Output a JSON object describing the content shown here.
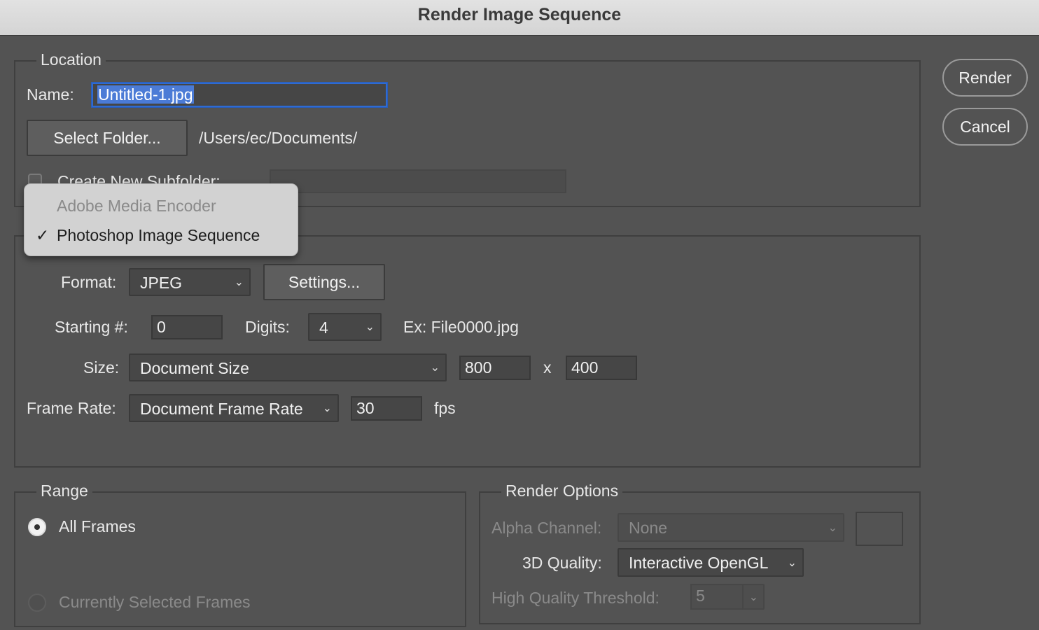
{
  "window": {
    "title": "Render Image Sequence"
  },
  "location": {
    "legend": "Location",
    "name_label": "Name:",
    "name_value": "Untitled-1.jpg",
    "select_folder_label": "Select Folder...",
    "folder_path": "/Users/ec/Documents/",
    "create_subfolder_label": "Create New Subfolder:",
    "create_subfolder_checked": false,
    "subfolder_value": ""
  },
  "renderer_menu": {
    "items": [
      {
        "label": "Adobe Media Encoder",
        "enabled": false,
        "checked": false
      },
      {
        "label": "Photoshop Image Sequence",
        "enabled": true,
        "checked": true
      }
    ],
    "checkmark": "✓"
  },
  "settings": {
    "format_label": "Format:",
    "format_value": "JPEG",
    "settings_button": "Settings...",
    "starting_label": "Starting #:",
    "starting_value": "0",
    "digits_label": "Digits:",
    "digits_value": "4",
    "example_text": "Ex: File0000.jpg",
    "size_label": "Size:",
    "size_value": "Document Size",
    "width_value": "800",
    "size_separator": "x",
    "height_value": "400",
    "frame_rate_label": "Frame Rate:",
    "frame_rate_value": "Document Frame Rate",
    "fps_value": "30",
    "fps_unit": "fps"
  },
  "range": {
    "legend": "Range",
    "all_frames_label": "All Frames",
    "all_frames_selected": true,
    "selected_frames_label": "Currently Selected Frames",
    "selected_frames_enabled": false
  },
  "render_options": {
    "legend": "Render Options",
    "alpha_label": "Alpha Channel:",
    "alpha_value": "None",
    "quality_label": "3D Quality:",
    "quality_value": "Interactive OpenGL",
    "threshold_label": "High Quality Threshold:",
    "threshold_value": "5"
  },
  "actions": {
    "render_label": "Render",
    "cancel_label": "Cancel"
  },
  "icons": {
    "chevron": "⌄"
  },
  "colors": {
    "dialog_bg": "#535353",
    "focus_ring": "#2f6bd1",
    "text_selection": "#4b7bd6"
  }
}
